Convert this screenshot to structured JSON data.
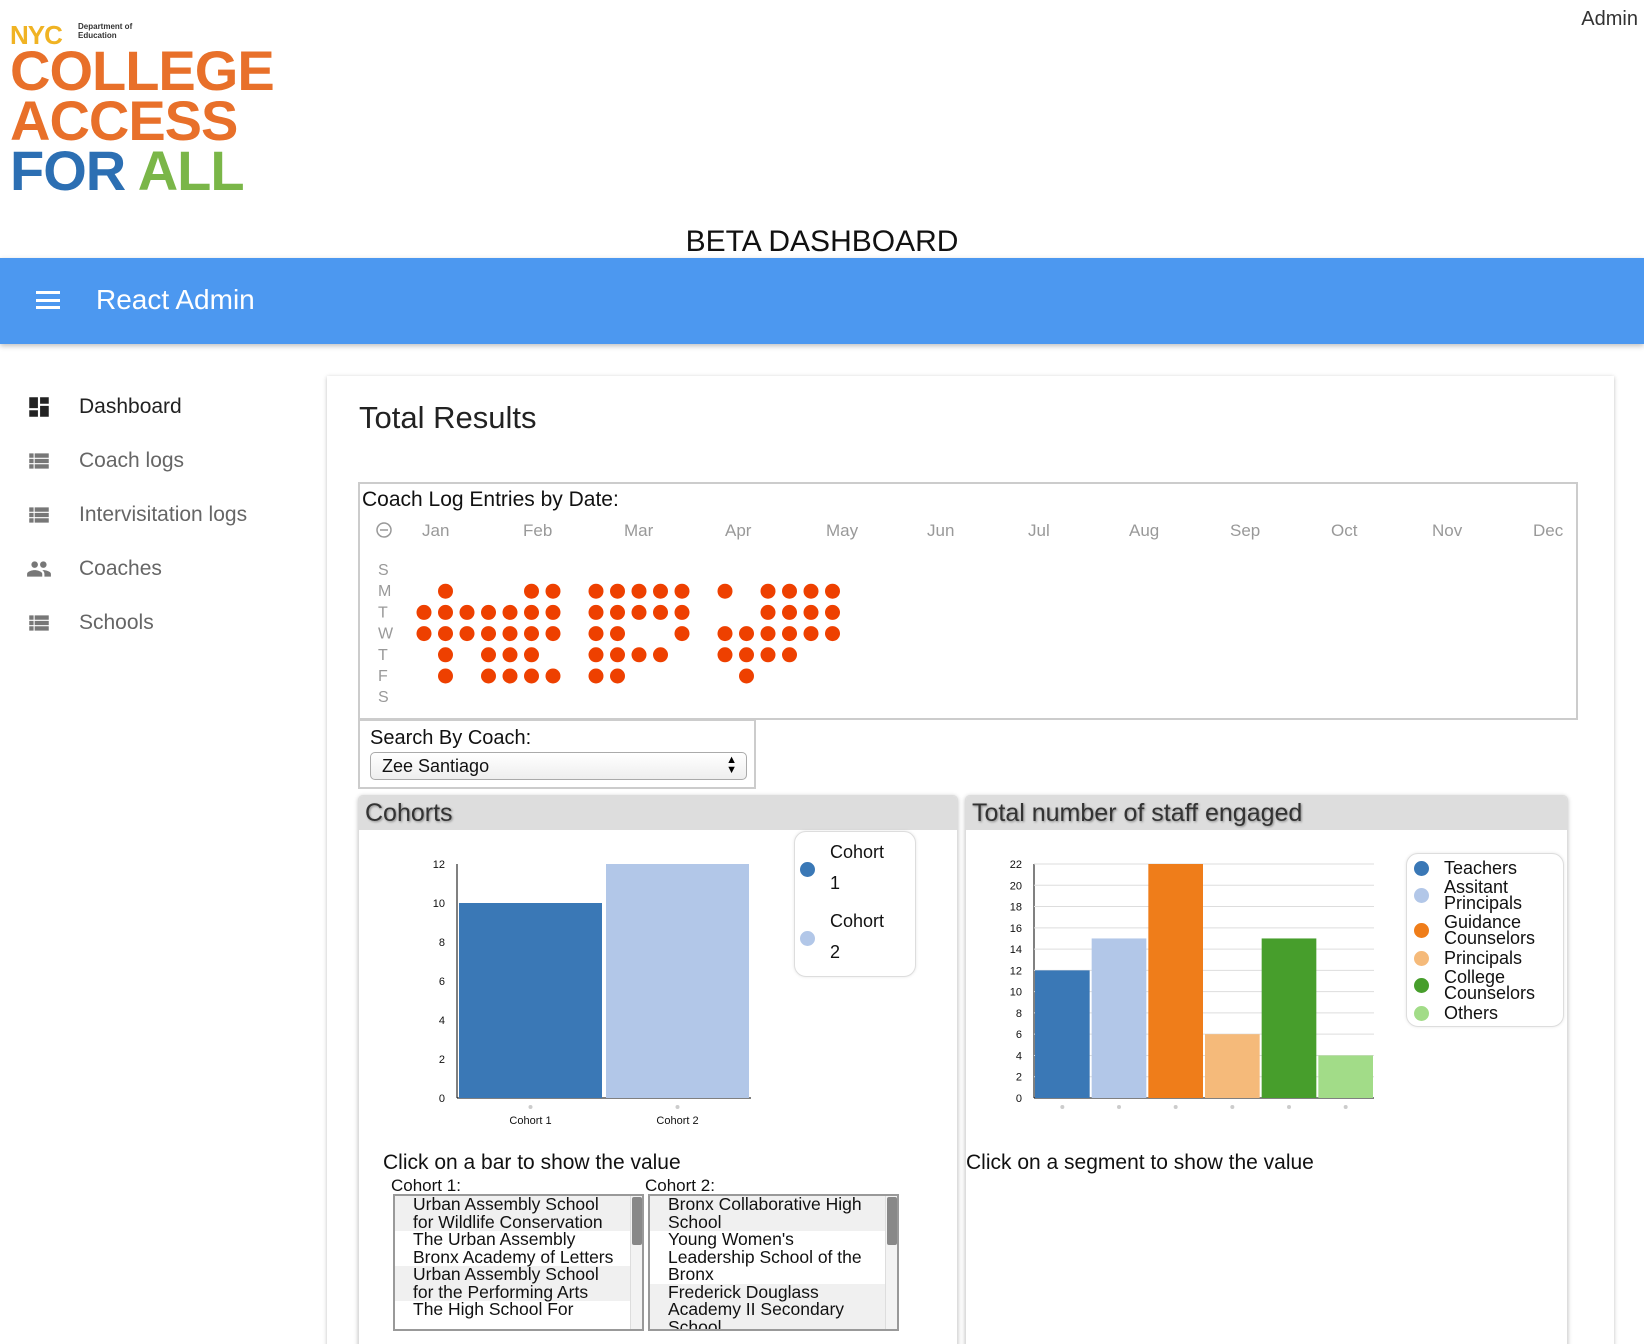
{
  "header": {
    "logo": {
      "nyc": "NYC",
      "doe": "Department of Education",
      "line1": "COLLEGE",
      "line2": "ACCESS",
      "line3a": "FOR",
      "line3b": "ALL"
    },
    "admin_label": "Admin",
    "beta_title": "BETA DASHBOARD"
  },
  "appbar": {
    "title": "React Admin",
    "menu_icon": "menu-icon"
  },
  "sidebar": {
    "items": [
      {
        "label": "Dashboard",
        "icon": "dashboard-icon"
      },
      {
        "label": "Coach logs",
        "icon": "list-icon"
      },
      {
        "label": "Intervisitation logs",
        "icon": "list-icon"
      },
      {
        "label": "Coaches",
        "icon": "people-icon"
      },
      {
        "label": "Schools",
        "icon": "list-icon"
      }
    ]
  },
  "main": {
    "title": "Total Results",
    "calendar": {
      "caption": "Coach Log Entries by Date:",
      "months": [
        "Jan",
        "Feb",
        "Mar",
        "Apr",
        "May",
        "Jun",
        "Jul",
        "Aug",
        "Sep",
        "Oct",
        "Nov",
        "Dec"
      ],
      "weekdays": [
        "S",
        "M",
        "T",
        "W",
        "T",
        "F",
        "S"
      ],
      "color": "#ee4000"
    },
    "search": {
      "caption": "Search By Coach:",
      "selected": "Zee Santiago"
    },
    "cohorts_panel": {
      "title": "Cohorts",
      "hint": "Click on a bar to show the value",
      "list1_label": "Cohort 1:",
      "list2_label": "Cohort 2:",
      "list1": [
        "Urban Assembly School for Wildlife Conservation",
        "The Urban Assembly Bronx Academy of Letters",
        "Urban Assembly School for the Performing Arts",
        "The High School For"
      ],
      "list2": [
        "Bronx Collaborative High School",
        "Young Women's Leadership School of the Bronx",
        "Frederick Douglass Academy II Secondary School"
      ],
      "legend": [
        {
          "line1": "Cohort",
          "line2": "1",
          "color": "#3a78b6"
        },
        {
          "line1": "Cohort",
          "line2": "2",
          "color": "#b2c7e8"
        }
      ]
    },
    "staff_panel": {
      "title": "Total number of staff engaged",
      "hint": "Click on a segment to show the value",
      "legend": [
        {
          "lines": [
            "Teachers"
          ],
          "color": "#3a78b6"
        },
        {
          "lines": [
            "Assitant",
            "Principals"
          ],
          "color": "#b2c7e8"
        },
        {
          "lines": [
            "Guidance",
            "Counselors"
          ],
          "color": "#ef7d1a"
        },
        {
          "lines": [
            "Principals"
          ],
          "color": "#f5ba7a"
        },
        {
          "lines": [
            "College",
            "Counselors"
          ],
          "color": "#479e2c"
        },
        {
          "lines": [
            "Others"
          ],
          "color": "#a2dc88"
        }
      ]
    }
  },
  "chart_data": [
    {
      "type": "scatter",
      "title": "Coach Log Entries by Date:",
      "x_months": [
        "Jan",
        "Feb",
        "Mar",
        "Apr",
        "May"
      ],
      "columns_by_week": [
        {
          "week": 1,
          "days": [
            "T",
            "W"
          ]
        },
        {
          "week": 2,
          "days": [
            "M",
            "T",
            "W",
            "T",
            "F"
          ]
        },
        {
          "week": 3,
          "days": [
            "T",
            "W"
          ]
        },
        {
          "week": 4,
          "days": [
            "T",
            "W",
            "T",
            "F"
          ]
        },
        {
          "week": 5,
          "days": [
            "T",
            "W",
            "T",
            "F"
          ]
        },
        {
          "week": 6,
          "days": [
            "M",
            "T",
            "W",
            "T",
            "F"
          ]
        },
        {
          "week": 7,
          "days": [
            "M",
            "T",
            "W",
            "F"
          ]
        },
        {
          "week": 9,
          "days": [
            "M",
            "T",
            "W",
            "T",
            "F"
          ]
        },
        {
          "week": 10,
          "days": [
            "M",
            "T",
            "W",
            "T",
            "F"
          ]
        },
        {
          "week": 11,
          "days": [
            "M",
            "T",
            "T"
          ]
        },
        {
          "week": 12,
          "days": [
            "M",
            "T",
            "T"
          ]
        },
        {
          "week": 13,
          "days": [
            "M",
            "T",
            "W"
          ]
        },
        {
          "week": 15,
          "days": [
            "M",
            "W",
            "T"
          ]
        },
        {
          "week": 16,
          "days": [
            "W",
            "T",
            "F"
          ]
        },
        {
          "week": 17,
          "days": [
            "M",
            "T",
            "W",
            "T"
          ]
        },
        {
          "week": 18,
          "days": [
            "M",
            "T",
            "W",
            "T"
          ]
        },
        {
          "week": 19,
          "days": [
            "M",
            "T",
            "W"
          ]
        },
        {
          "week": 20,
          "days": [
            "M",
            "T",
            "W"
          ]
        }
      ]
    },
    {
      "type": "bar",
      "categories": [
        "Cohort 1",
        "Cohort 2"
      ],
      "values": [
        10,
        12
      ],
      "ylim": [
        0,
        12
      ],
      "yticks": [
        0,
        2,
        4,
        6,
        8,
        10,
        12
      ],
      "colors": [
        "#3a78b6",
        "#b2c7e8"
      ]
    },
    {
      "type": "bar",
      "categories": [
        "Teachers",
        "Assitant Principals",
        "Guidance Counselors",
        "Principals",
        "College Counselors",
        "Others"
      ],
      "values": [
        12,
        15,
        22,
        6,
        15,
        4
      ],
      "ylim": [
        0,
        22
      ],
      "yticks": [
        0,
        2,
        4,
        6,
        8,
        10,
        12,
        14,
        16,
        18,
        20,
        22
      ],
      "colors": [
        "#3a78b6",
        "#b2c7e8",
        "#ef7d1a",
        "#f5ba7a",
        "#479e2c",
        "#a2dc88"
      ],
      "grid": true
    }
  ]
}
